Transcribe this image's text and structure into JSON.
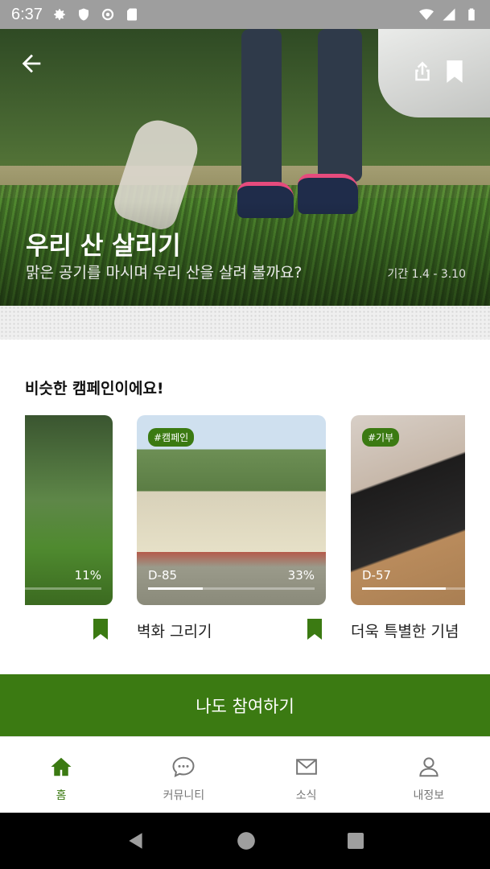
{
  "status_bar": {
    "time": "6:37"
  },
  "hero": {
    "title": "우리 산 살리기",
    "subtitle": "맑은 공기를 마시며 우리 산을 살려 볼까요?",
    "period": "기간 1.4 - 3.10"
  },
  "similar": {
    "title": "비슷한 캠페인이에요!",
    "cards": [
      {
        "tag": "",
        "dday": "",
        "percent": "11%",
        "progress": 0.11,
        "title": ""
      },
      {
        "tag": "#캠페인",
        "dday": "D-85",
        "percent": "33%",
        "progress": 0.33,
        "title": "벽화 그리기"
      },
      {
        "tag": "#기부",
        "dday": "D-57",
        "percent": "",
        "progress": 0.5,
        "title": "더욱 특별한 기념"
      }
    ]
  },
  "join_button": {
    "label": "나도 참여하기"
  },
  "bottom_nav": {
    "items": [
      {
        "label": "홈",
        "icon": "home-icon",
        "active": true
      },
      {
        "label": "커뮤니티",
        "icon": "chat-icon",
        "active": false
      },
      {
        "label": "소식",
        "icon": "mail-icon",
        "active": false
      },
      {
        "label": "내정보",
        "icon": "person-icon",
        "active": false
      }
    ]
  },
  "colors": {
    "accent": "#3b7a12",
    "nav_inactive": "#777777"
  }
}
